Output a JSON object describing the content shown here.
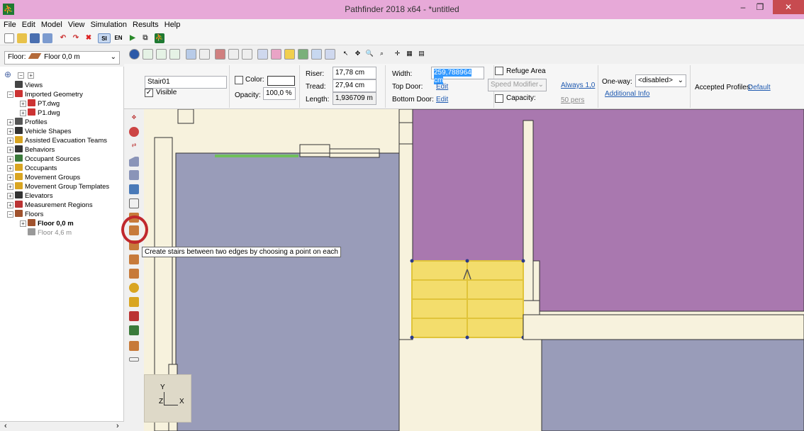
{
  "window": {
    "title": "Pathfinder 2018 x64 - *untitled",
    "minimize": "–",
    "restore": "❐",
    "close": "✕"
  },
  "menu": [
    "File",
    "Edit",
    "Model",
    "View",
    "Simulation",
    "Results",
    "Help"
  ],
  "toolbar": {
    "si_label": "SI",
    "en_label": "EN"
  },
  "floor_selector": {
    "label": "Floor:",
    "value": "Floor 0,0 m"
  },
  "properties": {
    "name": "Stair01",
    "visible_label": "Visible",
    "visible_checked": true,
    "color_label": "Color:",
    "opacity_label": "Opacity:",
    "opacity_value": "100,0 %",
    "riser_label": "Riser:",
    "riser_value": "17,78 cm",
    "tread_label": "Tread:",
    "tread_value": "27,94 cm",
    "length_label": "Length:",
    "length_value": "1,936709 m",
    "width_label": "Width:",
    "width_value": "259,788964 cm",
    "top_door_label": "Top Door:",
    "top_door_link": "Edit",
    "bottom_door_label": "Bottom Door:",
    "bottom_door_link": "Edit",
    "refuge_label": "Refuge Area",
    "speed_modifier": "Speed Modifier",
    "speed_value": "Always 1,0",
    "capacity_label": "Capacity:",
    "capacity_value": "50 pers",
    "oneway_label": "One-way:",
    "oneway_value": "<disabled>",
    "additional_info": "Additional Info",
    "accepted_profiles_label": "Accepted Profiles:",
    "accepted_profiles_value": "Default"
  },
  "tree": {
    "items": [
      {
        "label": "Views",
        "depth": 1,
        "icon": "views-icon",
        "color": "#444"
      },
      {
        "label": "Imported Geometry",
        "depth": 1,
        "icon": "geometry-icon",
        "color": "#c33"
      },
      {
        "label": "PT.dwg",
        "depth": 2,
        "icon": "dwg-icon",
        "color": "#c33"
      },
      {
        "label": "P1.dwg",
        "depth": 2,
        "icon": "dwg-icon",
        "color": "#c33"
      },
      {
        "label": "Profiles",
        "depth": 1,
        "icon": "profiles-icon",
        "color": "#555"
      },
      {
        "label": "Vehicle Shapes",
        "depth": 1,
        "icon": "vehicle-icon",
        "color": "#333"
      },
      {
        "label": "Assisted Evacuation Teams",
        "depth": 1,
        "icon": "team-icon",
        "color": "#d9a521"
      },
      {
        "label": "Behaviors",
        "depth": 1,
        "icon": "behavior-icon",
        "color": "#333"
      },
      {
        "label": "Occupant Sources",
        "depth": 1,
        "icon": "source-icon",
        "color": "#3a7a3a"
      },
      {
        "label": "Occupants",
        "depth": 1,
        "icon": "occupant-icon",
        "color": "#d9a521"
      },
      {
        "label": "Movement Groups",
        "depth": 1,
        "icon": "group-icon",
        "color": "#d9a521"
      },
      {
        "label": "Movement Group Templates",
        "depth": 1,
        "icon": "template-icon",
        "color": "#d9a521"
      },
      {
        "label": "Elevators",
        "depth": 1,
        "icon": "elevator-icon",
        "color": "#333"
      },
      {
        "label": "Measurement Regions",
        "depth": 1,
        "icon": "region-icon",
        "color": "#b33"
      },
      {
        "label": "Floors",
        "depth": 1,
        "icon": "floors-icon",
        "color": "#a0522d"
      },
      {
        "label": "Floor 0,0 m",
        "depth": 2,
        "icon": "floor-icon",
        "color": "#a0522d",
        "bold": true
      },
      {
        "label": "Floor 4,6 m",
        "depth": 2,
        "icon": "floor-icon",
        "color": "#999",
        "muted": true
      }
    ]
  },
  "tooltip": "Create stairs between two edges by choosing a point on each",
  "axis": {
    "y": "Y",
    "z": "Z",
    "x": "X"
  },
  "colors": {
    "titlebar": "#e7a9d8",
    "room_blue": "#999cb9",
    "room_purple": "#a978af",
    "stair_yellow": "#f3dd6c",
    "highlight_circle": "#c0282d"
  }
}
